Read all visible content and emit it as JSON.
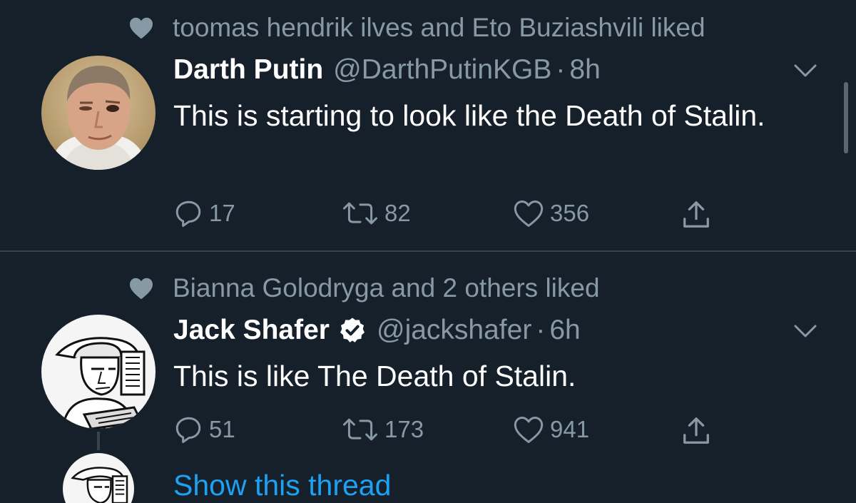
{
  "tweets": [
    {
      "social_context": "toomas hendrik ilves and Eto Buziashvili liked",
      "display_name": "Darth Putin",
      "handle": "@DarthPutinKGB",
      "separator": "·",
      "time": "8h",
      "verified": false,
      "text": "This is starting to look like the Death of Stalin.",
      "replies": "17",
      "retweets": "82",
      "likes": "356"
    },
    {
      "social_context": "Bianna Golodryga and 2 others liked",
      "display_name": "Jack Shafer",
      "handle": "@jackshafer",
      "separator": "·",
      "time": "6h",
      "verified": true,
      "text": "This is like The Death of Stalin.",
      "replies": "51",
      "retweets": "173",
      "likes": "941",
      "show_thread": "Show this thread"
    }
  ],
  "colors": {
    "background": "#15202b",
    "secondary_text": "#8899a6",
    "link": "#1da1f2",
    "divider": "#38444d"
  },
  "icons": [
    "heart-solid-icon",
    "chevron-down-icon",
    "reply-icon",
    "retweet-icon",
    "like-icon",
    "share-icon",
    "verified-badge-icon"
  ]
}
